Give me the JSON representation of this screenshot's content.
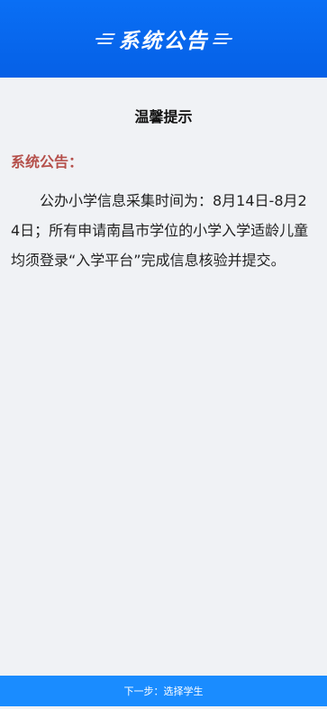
{
  "header": {
    "title": "系统公告"
  },
  "notice": {
    "title": "温馨提示",
    "label": "系统公告：",
    "body": "公办小学信息采集时间为：8月14日-8月24日；所有申请南昌市学位的小学入学适龄儿童均须登录“入学平台”完成信息核验并提交。"
  },
  "footer": {
    "next_label": "下一步：选择学生"
  },
  "colors": {
    "header_bg": "#0a6ff5",
    "accent_label": "#b5504b",
    "button_bg": "#1a8cff",
    "page_bg": "#f0f2f5"
  }
}
